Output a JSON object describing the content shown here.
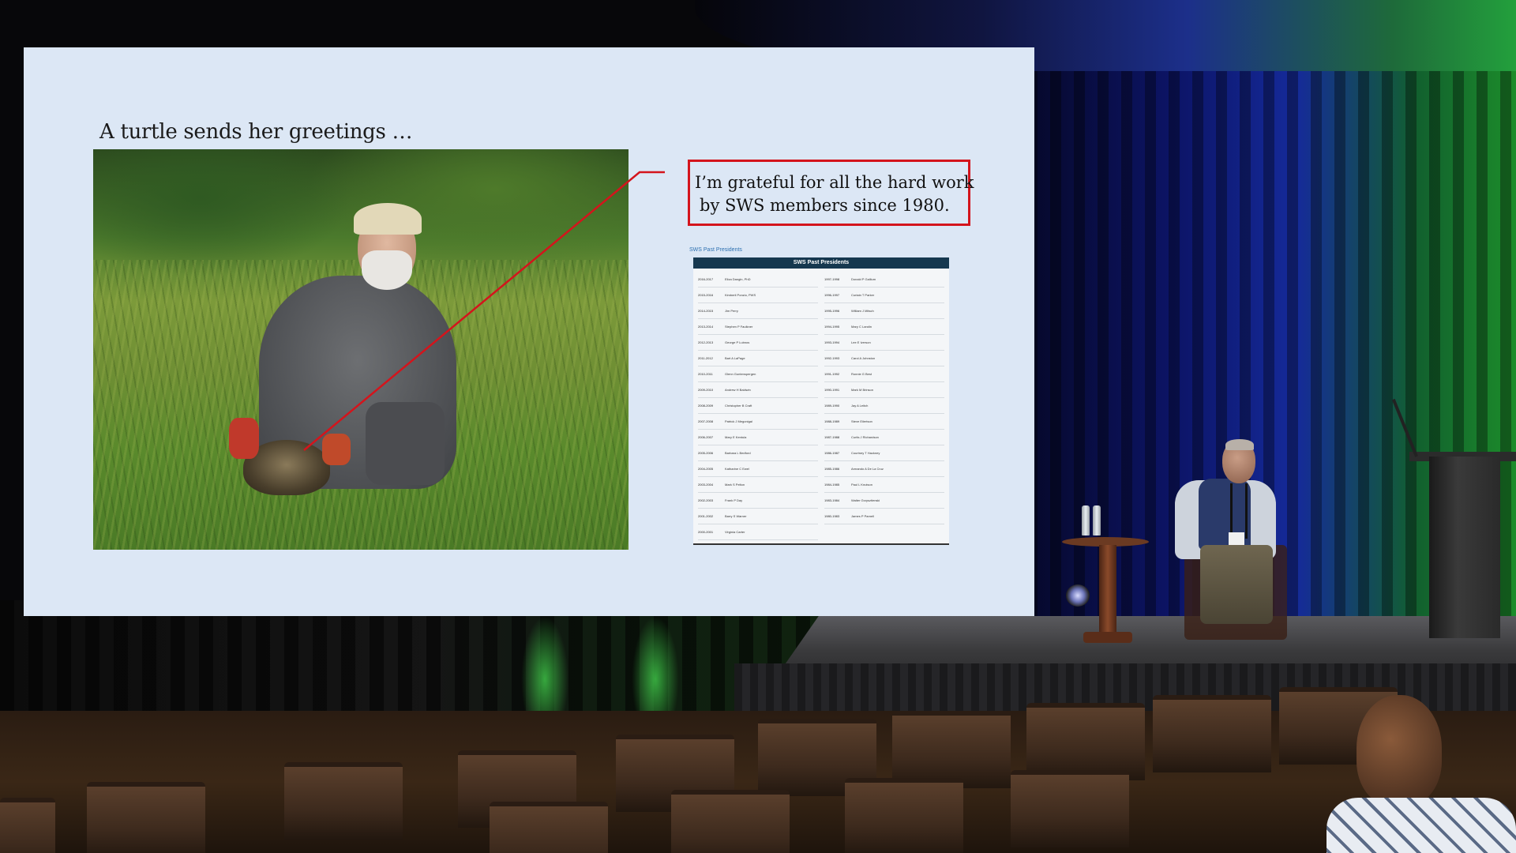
{
  "slide": {
    "title": "A turtle sends her greetings …",
    "callout_line1": "I’m grateful for all the hard work",
    "callout_line2": "by SWS members since 1980.",
    "table_caption": "SWS Past Presidents",
    "table_header": "SWS Past Presidents",
    "table_col1": [
      {
        "year": "2016-2017",
        "name": "Eliza Dangin, PhD"
      },
      {
        "year": "2015-2016",
        "name": "Kimberli Ponzio, PWS"
      },
      {
        "year": "2014-2015",
        "name": "Jim Perry"
      },
      {
        "year": "2013-2014",
        "name": "Stephen P Faulkner"
      },
      {
        "year": "2012-2013",
        "name": "George P Lubnos"
      },
      {
        "year": "2011-2012",
        "name": "Bart A LaPage"
      },
      {
        "year": "2010-2011",
        "name": "Glenn Guntenspergen"
      },
      {
        "year": "2009-2010",
        "name": "Andrew H Baldwin"
      },
      {
        "year": "2008-2009",
        "name": "Christopher B Craft"
      },
      {
        "year": "2007-2008",
        "name": "Patrick J Megonigal"
      },
      {
        "year": "2006-2007",
        "name": "Mary E Kentula"
      },
      {
        "year": "2005-2006",
        "name": "Barbara L Bedford"
      },
      {
        "year": "2004-2005",
        "name": "Katharine C Ewel"
      },
      {
        "year": "2003-2004",
        "name": "Mark S Pelton"
      },
      {
        "year": "2002-2003",
        "name": "Frank P Day"
      },
      {
        "year": "2001-2002",
        "name": "Barry S Warner"
      },
      {
        "year": "2000-2001",
        "name": "Virginia Carter"
      },
      {
        "year": "1999-2000",
        "name": "Jarrel P Keough"
      },
      {
        "year": "1998-1999",
        "name": "John M Teal"
      }
    ],
    "table_col2": [
      {
        "year": "1997-1998",
        "name": "Donald P Gallium"
      },
      {
        "year": "1996-1997",
        "name": "Curtain T Parker"
      },
      {
        "year": "1995-1996",
        "name": "William J Mitsch"
      },
      {
        "year": "1994-1995",
        "name": "Mary C Landin"
      },
      {
        "year": "1993-1994",
        "name": "Lee E Iverson"
      },
      {
        "year": "1992-1993",
        "name": "Carol A Johnston"
      },
      {
        "year": "1991-1992",
        "name": "Ronnie G Best"
      },
      {
        "year": "1990-1991",
        "name": "Mark M Brinson"
      },
      {
        "year": "1989-1990",
        "name": "Jay A Leitch"
      },
      {
        "year": "1988-1989",
        "name": "Steve Eilertson"
      },
      {
        "year": "1987-1988",
        "name": "Curtis J Richardson"
      },
      {
        "year": "1986-1987",
        "name": "Courtney T Hackney"
      },
      {
        "year": "1985-1986",
        "name": "Armando A De La Cruz"
      },
      {
        "year": "1984-1985",
        "name": "Paul L Knutson"
      },
      {
        "year": "1983-1984",
        "name": "Walter Grzysztienski"
      },
      {
        "year": "1980-1983",
        "name": "James P Parnell"
      }
    ]
  },
  "colors": {
    "slide_background": "#dce7f5",
    "callout_border": "#d4141c",
    "table_header": "#16384f"
  }
}
